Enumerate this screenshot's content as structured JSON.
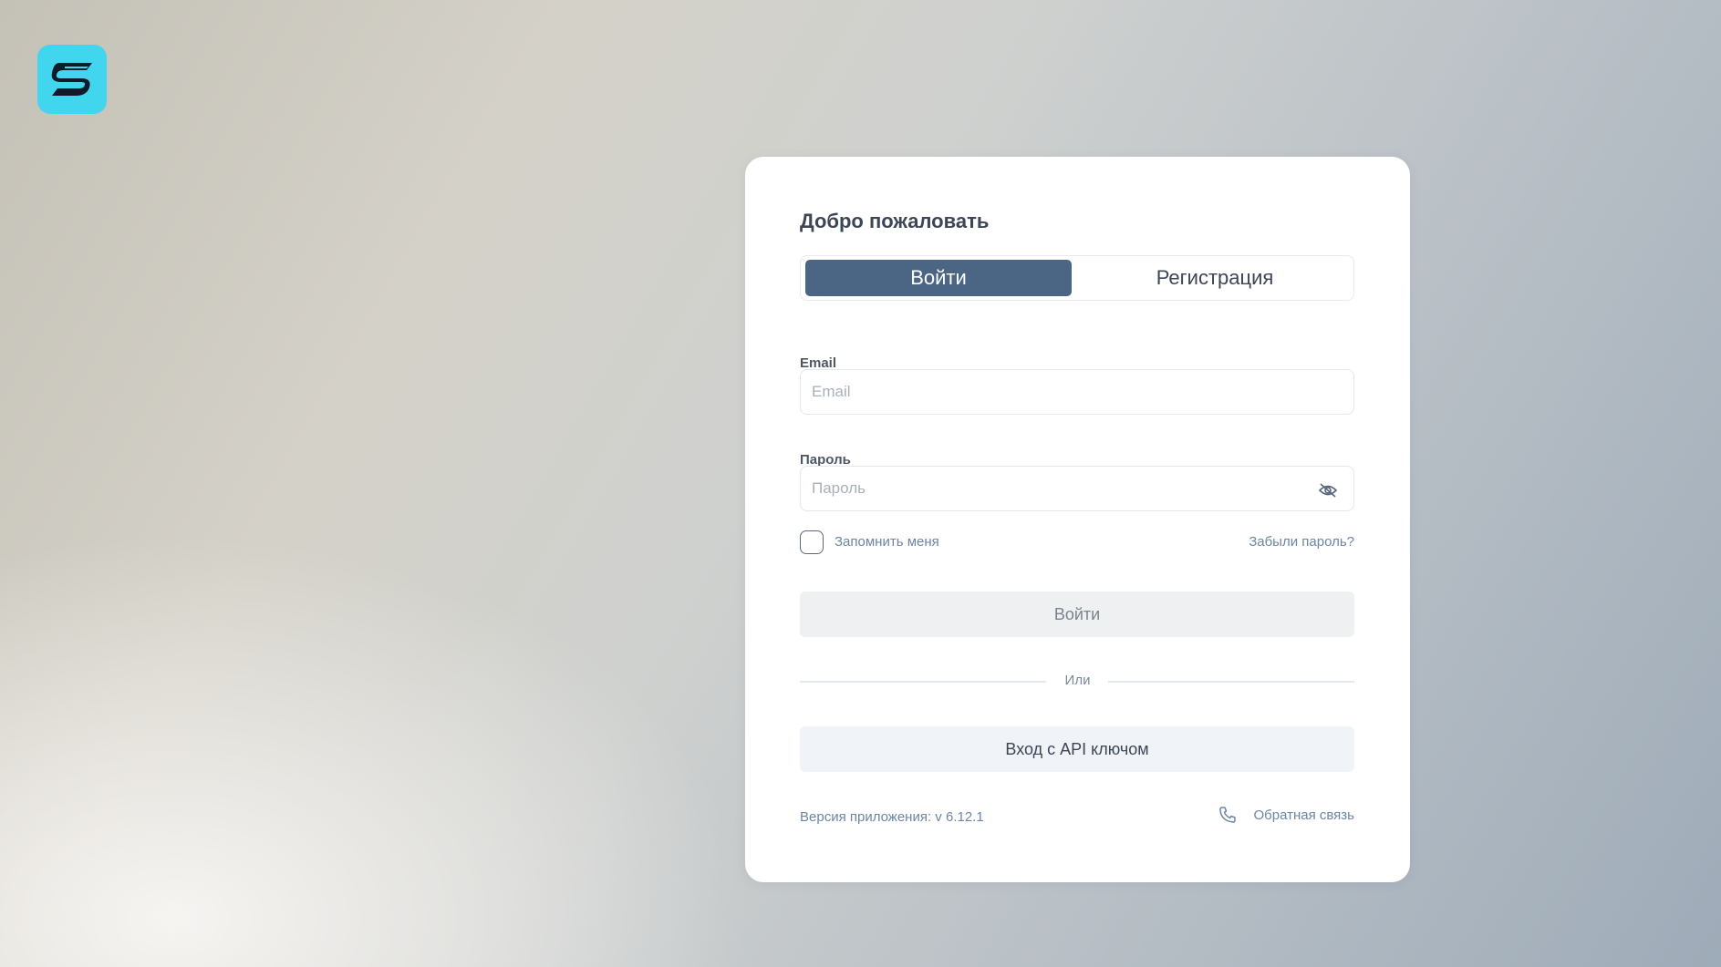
{
  "app": {
    "logo_icon": "app-logo-icon",
    "accent_color": "#41d5ee"
  },
  "auth_card": {
    "title": "Добро пожаловать",
    "tabs": [
      {
        "label": "Войти",
        "active": true
      },
      {
        "label": "Регистрация",
        "active": false
      }
    ],
    "email": {
      "label": "Email",
      "value": "",
      "placeholder": "Email"
    },
    "password": {
      "label": "Пароль",
      "value": "",
      "placeholder": "Пароль",
      "toggle_icon": "eye-off-icon"
    },
    "remember_me": {
      "label": "Запомнить меня",
      "checked": false
    },
    "forgot_password": "Забыли пароль?",
    "submit_label": "Войти",
    "divider_text": "Или",
    "api_key_login_label": "Вход с API ключом",
    "footer": {
      "version_text": "Версия приложения: v 6.12.1",
      "feedback_label": "Обратная связь",
      "feedback_icon": "phone-icon"
    },
    "colors": {
      "tab_active_bg": "#4b6584",
      "link": "#6c86a3"
    }
  }
}
